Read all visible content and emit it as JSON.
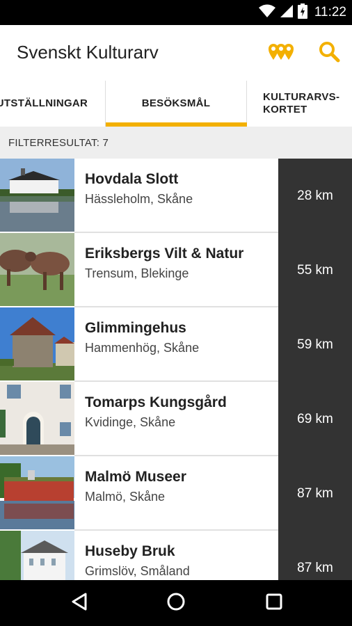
{
  "status_bar": {
    "time": "11:22"
  },
  "app_bar": {
    "title": "Svenskt Kulturarv",
    "accent": "#f3b000",
    "actions": [
      "map-markers-icon",
      "search-icon"
    ]
  },
  "tabs": [
    {
      "label": "UTSTÄLLNINGAR",
      "selected": false
    },
    {
      "label": "BESÖKSMÅL",
      "selected": true
    },
    {
      "label_line1": "KULTURARVS-",
      "label_line2": "KORTET",
      "selected": false
    }
  ],
  "filter": {
    "label": "FILTERRESULTAT: 7"
  },
  "places": [
    {
      "name": "Hovdala Slott",
      "location": "Hässleholm, Skåne",
      "distance": "28 km"
    },
    {
      "name": "Eriksbergs Vilt & Natur",
      "location": "Trensum, Blekinge",
      "distance": "55 km"
    },
    {
      "name": "Glimmingehus",
      "location": "Hammenhög, Skåne",
      "distance": "59 km"
    },
    {
      "name": "Tomarps Kungsgård",
      "location": "Kvidinge, Skåne",
      "distance": "69 km"
    },
    {
      "name": "Malmö Museer",
      "location": "Malmö, Skåne",
      "distance": "87 km"
    },
    {
      "name": "Huseby Bruk",
      "location": "Grimslöv, Småland",
      "distance": "87 km"
    }
  ]
}
